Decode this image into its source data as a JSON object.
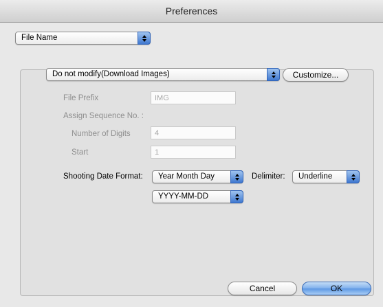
{
  "window": {
    "title": "Preferences"
  },
  "category_popup": {
    "value": "File Name"
  },
  "rename_mode": {
    "value": "Do not modify(Download Images)",
    "customize_label": "Customize..."
  },
  "file_prefix": {
    "label": "File Prefix",
    "value": "IMG"
  },
  "sequence": {
    "label": "Assign Sequence No. :",
    "digits_label": "Number of Digits",
    "digits_value": "4",
    "start_label": "Start",
    "start_value": "1"
  },
  "shooting_date": {
    "label": "Shooting Date Format:",
    "value": "Year Month Day",
    "format_value": "YYYY-MM-DD"
  },
  "delimiter": {
    "label": "Delimiter:",
    "value": "Underline"
  },
  "footer": {
    "cancel_label": "Cancel",
    "ok_label": "OK"
  },
  "colors": {
    "accent": "#5c97e3",
    "disabled_text": "#8e8e8e"
  }
}
